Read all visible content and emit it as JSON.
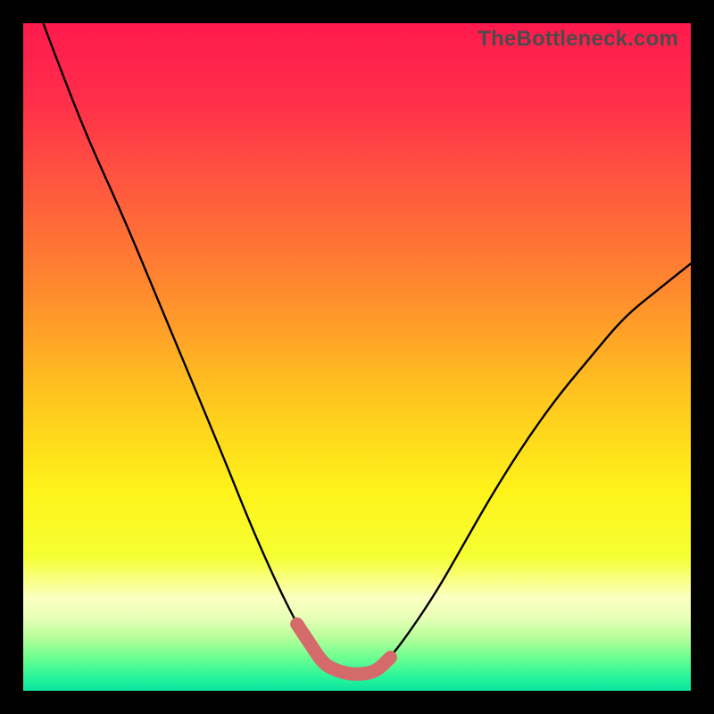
{
  "watermark": "TheBottleneck.com",
  "chart_data": {
    "type": "line",
    "title": "",
    "xlabel": "",
    "ylabel": "",
    "xlim": [
      0,
      100
    ],
    "ylim": [
      0,
      100
    ],
    "series": [
      {
        "name": "black-curve",
        "x": [
          3,
          6,
          10,
          15,
          20,
          25,
          30,
          34,
          38,
          41,
          43,
          45,
          47,
          49,
          51,
          53,
          55,
          58,
          62,
          66,
          70,
          75,
          80,
          85,
          90,
          95,
          100
        ],
        "y": [
          100,
          92,
          82,
          71,
          59,
          47,
          35,
          25,
          16,
          10,
          7,
          4,
          3,
          2.5,
          2.5,
          3,
          5,
          9,
          15,
          22,
          29,
          37,
          44,
          50,
          56,
          60,
          64
        ],
        "marker_segment": {
          "x_from": 41,
          "x_to": 55
        }
      }
    ],
    "gradient_stops": [
      {
        "offset": 0.0,
        "color": "#ff1a4d"
      },
      {
        "offset": 0.12,
        "color": "#ff2f4a"
      },
      {
        "offset": 0.25,
        "color": "#ff5a3e"
      },
      {
        "offset": 0.4,
        "color": "#ff8a2e"
      },
      {
        "offset": 0.55,
        "color": "#ffc21f"
      },
      {
        "offset": 0.7,
        "color": "#fff31a"
      },
      {
        "offset": 0.8,
        "color": "#f5ff33"
      },
      {
        "offset": 0.86,
        "color": "#fcffc0"
      },
      {
        "offset": 0.89,
        "color": "#e9ffb8"
      },
      {
        "offset": 0.92,
        "color": "#b7ff9a"
      },
      {
        "offset": 0.95,
        "color": "#6dff90"
      },
      {
        "offset": 0.98,
        "color": "#27f59a"
      },
      {
        "offset": 1.0,
        "color": "#0ce3a0"
      }
    ],
    "marker_color": "#d46a6a",
    "curve_color": "#000000"
  }
}
